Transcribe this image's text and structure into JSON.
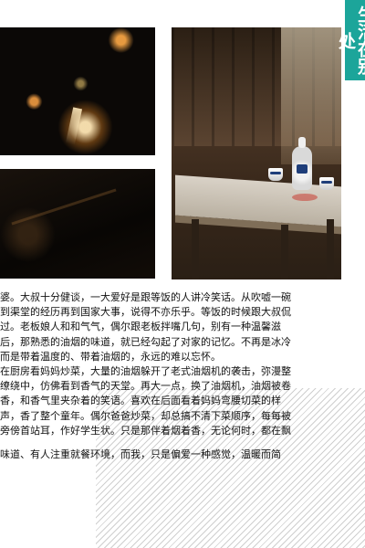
{
  "side_title": "生活在别处",
  "article": {
    "paragraph_1": [
      "婆。大叔十分健谈，一大爱好是跟等饭的人讲冷笑话。从吹嘘一碗",
      "到渠堂的经历再到国家大事，说得不亦乐乎。等饭的时候跟大叔侃",
      "过。老板娘人和和气气，偶尔跟老板拌嘴几句，别有一种温馨滋",
      "后，那熟悉的油烟的味道，就已经勾起了对家的记忆。不再是冰冷",
      "而是带着温度的、带着油烟的，永远的难以忘怀。"
    ],
    "paragraph_2": [
      "在厨房看妈妈炒菜，大量的油烟躲开了老式油烟机的袭击，弥漫整",
      "缭绕中，仿佛看到香气的天堂。再大一点，换了油烟机，油烟被卷",
      "香，和香气里夹杂着的笑语。喜欢在后面看着妈妈弯腰切菜的样",
      "声，香了整个童年。偶尔爸爸炒菜，却总搞不清下菜顺序，每每被",
      "旁傍首站耳，作好学生状。只是那伴着烟着香，无论何时，都在飘"
    ],
    "paragraph_3": [
      "味道、有人注重就餐环境，而我，只是偏爱一种感觉，温暖而简"
    ]
  }
}
